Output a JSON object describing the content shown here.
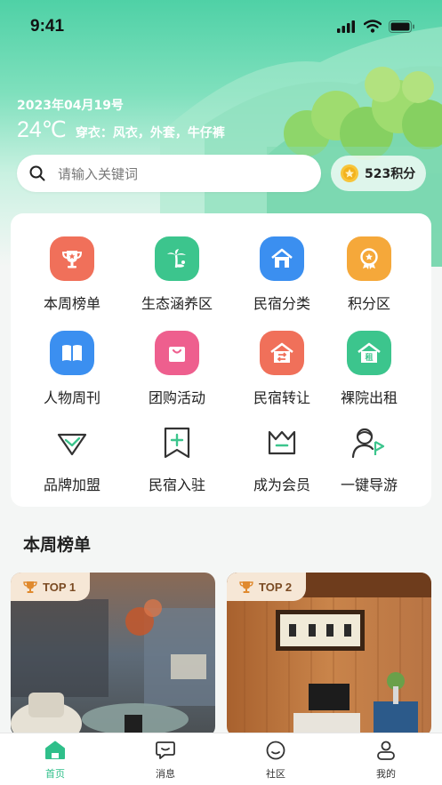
{
  "status_bar": {
    "time": "9:41"
  },
  "header": {
    "date": "2023年04月19号",
    "temperature": "24℃",
    "outfit": "穿衣：风衣，外套，牛仔裤"
  },
  "search": {
    "placeholder": "请输入关键词",
    "icon": "search-icon"
  },
  "points": {
    "label": "523积分",
    "icon": "coin-icon"
  },
  "grid": [
    {
      "label": "本周榜单",
      "icon": "trophy-icon",
      "color": "#f0705a"
    },
    {
      "label": "生态涵养区",
      "icon": "palm-tree-icon",
      "color": "#3cc58d"
    },
    {
      "label": "民宿分类",
      "icon": "house-icon",
      "color": "#3b8ff0"
    },
    {
      "label": "积分区",
      "icon": "medal-icon",
      "color": "#f5a83a"
    },
    {
      "label": "人物周刊",
      "icon": "book-icon",
      "color": "#3b8ff0"
    },
    {
      "label": "团购活动",
      "icon": "shopping-bag-icon",
      "color": "#ee5f8e"
    },
    {
      "label": "民宿转让",
      "icon": "house-transfer-icon",
      "color": "#f0705a"
    },
    {
      "label": "裸院出租",
      "icon": "house-rent-icon",
      "color": "#3cc58d"
    },
    {
      "label": "品牌加盟",
      "icon": "diamond-icon",
      "color": "#3cc58d"
    },
    {
      "label": "民宿入驻",
      "icon": "bookmark-plus-icon",
      "color": "#333333"
    },
    {
      "label": "成为会员",
      "icon": "member-icon",
      "color": "#333333"
    },
    {
      "label": "一键导游",
      "icon": "guide-icon",
      "color": "#333333"
    }
  ],
  "rent_char": "租",
  "section": {
    "title": "本周榜单"
  },
  "ranking": [
    {
      "badge": "TOP 1"
    },
    {
      "badge": "TOP 2"
    }
  ],
  "tabbar": [
    {
      "label": "首页",
      "icon": "home-icon",
      "active": true
    },
    {
      "label": "消息",
      "icon": "message-icon",
      "active": false
    },
    {
      "label": "社区",
      "icon": "community-icon",
      "active": false
    },
    {
      "label": "我的",
      "icon": "profile-icon",
      "active": false
    }
  ],
  "colors": {
    "accent": "#2fbf8a",
    "badge_bg": "#f6e7d6"
  }
}
